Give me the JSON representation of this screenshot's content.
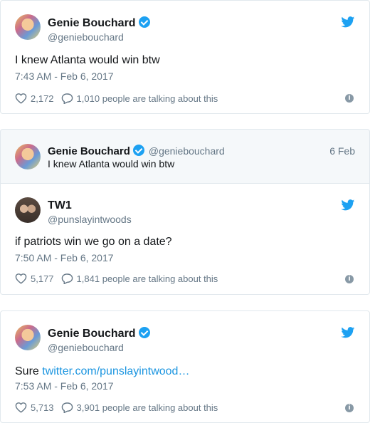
{
  "tweets": [
    {
      "author": "Genie Bouchard",
      "handle": "@geniebouchard",
      "verified": true,
      "text": "I knew Atlanta would win btw",
      "timestamp": "7:43 AM - Feb 6, 2017",
      "likes": "2,172",
      "talking": "1,010 people are talking about this"
    },
    {
      "author": "TW1",
      "handle": "@punslayintwoods",
      "verified": false,
      "text": "if patriots win we go on a date?",
      "timestamp": "7:50 AM - Feb 6, 2017",
      "likes": "5,177",
      "talking": "1,841 people are talking about this"
    },
    {
      "author": "Genie Bouchard",
      "handle": "@geniebouchard",
      "verified": true,
      "text_prefix": "Sure ",
      "link": "twitter.com/punslayintwood…",
      "timestamp": "7:53 AM - Feb 6, 2017",
      "likes": "5,713",
      "talking": "3,901 people are talking about this"
    }
  ],
  "quoted": {
    "author": "Genie Bouchard",
    "handle": "@geniebouchard",
    "date": "6 Feb",
    "text": "I knew Atlanta would win btw"
  },
  "icons": {
    "bird": "twitter-bird-icon",
    "heart": "heart-icon",
    "reply": "reply-bubble-icon",
    "info": "info-icon",
    "verified": "verified-badge-icon"
  },
  "colors": {
    "brand": "#1da1f2",
    "link": "#1b95e0",
    "muted": "#657786"
  },
  "info_glyph": "i"
}
